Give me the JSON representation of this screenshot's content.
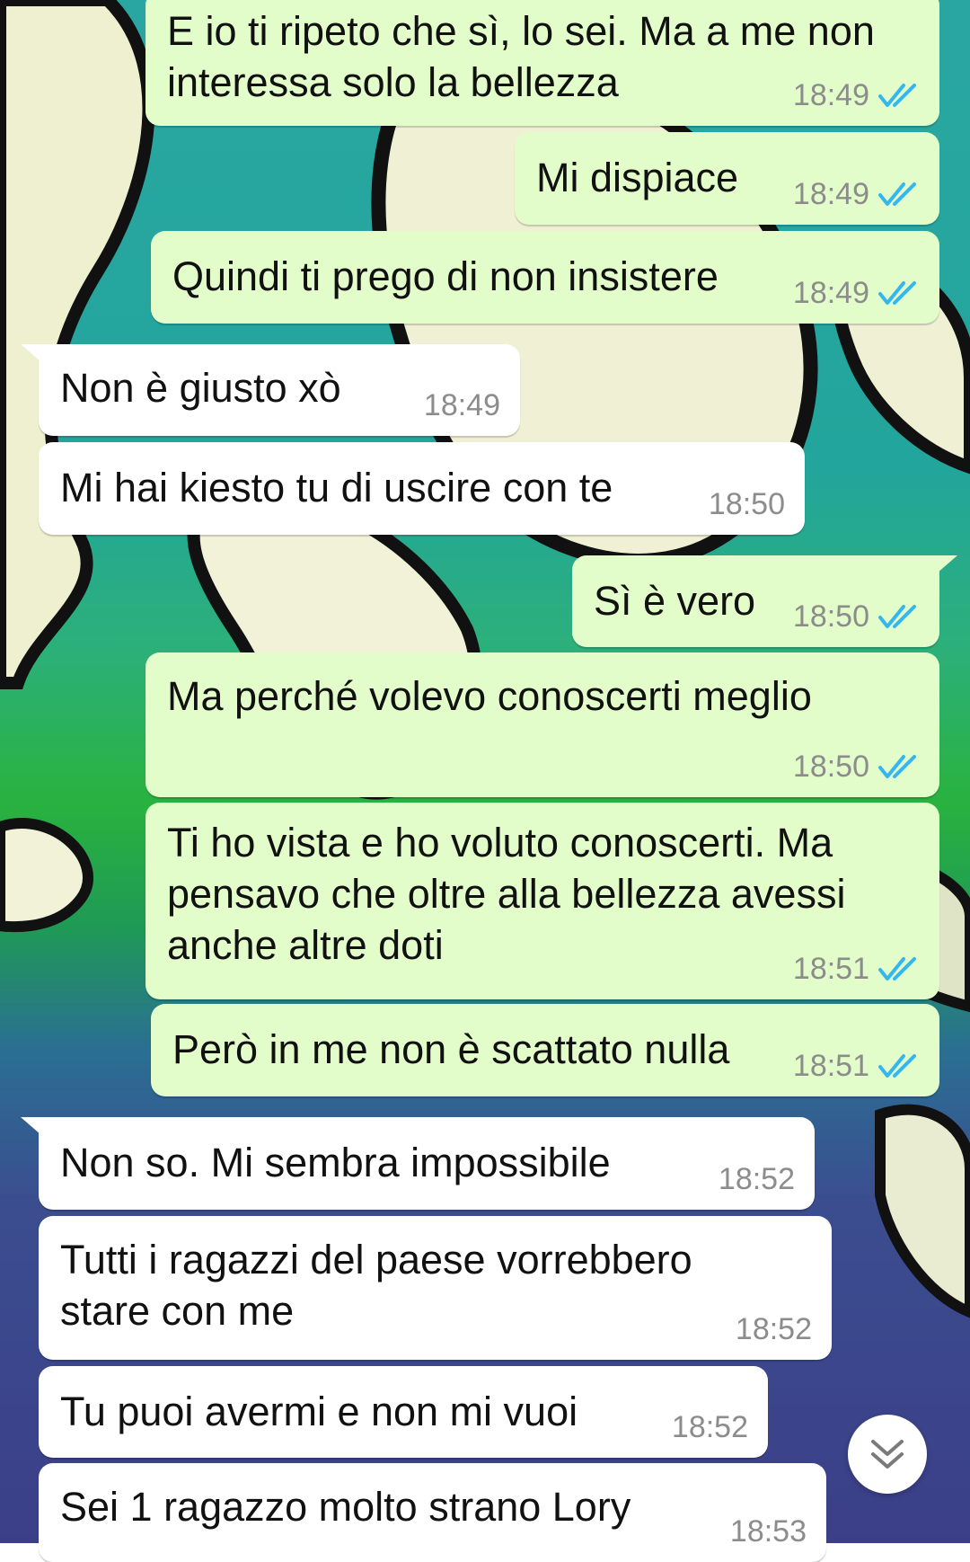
{
  "conversation": {
    "messages": [
      {
        "direction": "out",
        "text": "E io ti ripeto che sì, lo sei. Ma a me non\ninteressa solo la bellezza",
        "time": "18:49",
        "read": true
      },
      {
        "direction": "out",
        "text": "Mi dispiace",
        "time": "18:49",
        "read": true
      },
      {
        "direction": "out",
        "text": "Quindi ti prego di non insistere",
        "time": "18:49",
        "read": true
      },
      {
        "direction": "in",
        "text": "Non è giusto xò",
        "time": "18:49"
      },
      {
        "direction": "in",
        "text": "Mi hai kiesto tu di uscire con te",
        "time": "18:50"
      },
      {
        "direction": "out",
        "text": "Sì è vero",
        "time": "18:50",
        "read": true
      },
      {
        "direction": "out",
        "text": "Ma perché volevo conoscerti meglio",
        "time": "18:50",
        "read": true
      },
      {
        "direction": "out",
        "text": "Ti ho vista e ho voluto conoscerti. Ma\npensavo che oltre alla bellezza avessi\nanche altre doti",
        "time": "18:51",
        "read": true
      },
      {
        "direction": "out",
        "text": "Però in me non è scattato nulla",
        "time": "18:51",
        "read": true
      },
      {
        "direction": "in",
        "text": "Non so. Mi sembra impossibile",
        "time": "18:52"
      },
      {
        "direction": "in",
        "text": "Tutti i ragazzi del paese vorrebbero\nstare con me",
        "time": "18:52"
      },
      {
        "direction": "in",
        "text": "Tu puoi avermi e non mi vuoi",
        "time": "18:52"
      },
      {
        "direction": "in",
        "text": "Sei 1 ragazzo molto strano Lory",
        "time": "18:53"
      }
    ]
  },
  "icons": {
    "read_receipt": "double-check-icon",
    "scroll_down": "chevron-double-down-icon"
  },
  "colors": {
    "outgoing_bubble": "#e2fdc9",
    "incoming_bubble": "#ffffff",
    "read_tick": "#34b7f1",
    "timestamp": "#8c8c8c"
  }
}
